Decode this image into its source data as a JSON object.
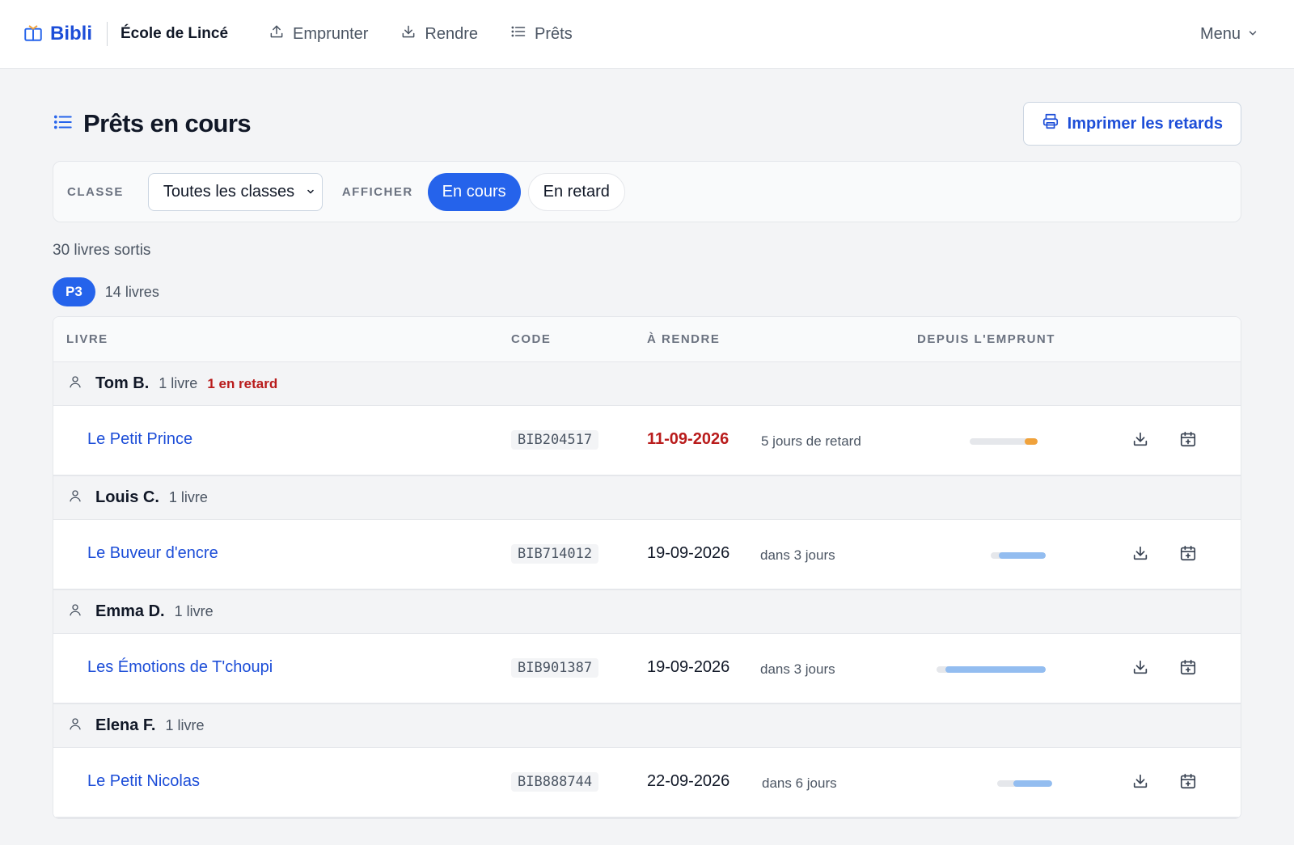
{
  "nav": {
    "brand": "Bibli",
    "school": "École de Lincé",
    "links": [
      {
        "label": "Emprunter",
        "icon": "upload-icon"
      },
      {
        "label": "Rendre",
        "icon": "download-icon"
      },
      {
        "label": "Prêts",
        "icon": "list-icon"
      }
    ],
    "menu_label": "Menu"
  },
  "page": {
    "title": "Prêts en cours",
    "print_label": "Imprimer les retards"
  },
  "filters": {
    "class_label": "CLASSE",
    "class_value": "Toutes les classes",
    "show_label": "AFFICHER",
    "options": [
      "En cours",
      "En retard"
    ],
    "active_option": "En cours"
  },
  "summary": {
    "count_text": "30 livres sortis",
    "class_badge": "P3",
    "class_count": "14 livres"
  },
  "table": {
    "headers": {
      "book": "LIVRE",
      "code": "CODE",
      "due": "À RENDRE",
      "since": "DEPUIS L'EMPRUNT"
    },
    "groups": [
      {
        "student": "Tom B.",
        "qty": "1 livre",
        "late": "1 en retard",
        "loan": {
          "book": "Le Petit Prince",
          "code": "BIB204517",
          "due": "11-09-2026",
          "relative": "5 jours de retard",
          "overdue": true,
          "elapsed_fraction": 0.19,
          "bar_color": "#f0a23b"
        }
      },
      {
        "student": "Louis C.",
        "qty": "1 livre",
        "late": "",
        "loan": {
          "book": "Le Buveur d'encre",
          "code": "BIB714012",
          "due": "19-09-2026",
          "relative": "dans 3 jours",
          "overdue": false,
          "elapsed_fraction": 0.85,
          "bar_color": "#93bdf0"
        }
      },
      {
        "student": "Emma D.",
        "qty": "1 livre",
        "late": "",
        "loan": {
          "book": "Les Émotions de T'choupi",
          "code": "BIB901387",
          "due": "19-09-2026",
          "relative": "dans 3 jours",
          "overdue": false,
          "elapsed_fraction": 0.92,
          "bar_color": "#93bdf0"
        }
      },
      {
        "student": "Elena F.",
        "qty": "1 livre",
        "late": "",
        "loan": {
          "book": "Le Petit Nicolas",
          "code": "BIB888744",
          "due": "22-09-2026",
          "relative": "dans 6 jours",
          "overdue": false,
          "elapsed_fraction": 0.7,
          "bar_color": "#93bdf0"
        }
      }
    ]
  }
}
